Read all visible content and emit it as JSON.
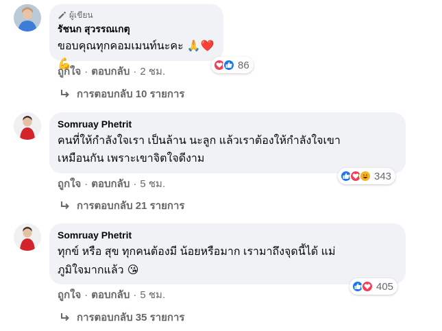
{
  "comments": [
    {
      "badge": "ผู้เขียน",
      "author": "รัชนก สุวรรณเกตุ",
      "lines": [
        "ขอบคุณทุกคอมเมนท์นะคะ 🙏❤️💪"
      ],
      "reaction_count": "86",
      "reaction_icons": [
        "love-icon",
        "like-icon"
      ],
      "like_label": "ถูกใจ",
      "reply_label": "ตอบกลับ",
      "time": "2 ชม.",
      "replies_label": "การตอบกลับ 10 รายการ"
    },
    {
      "author": "Somruay Phetrit",
      "lines": [
        "คนที่ให้กำลังใจเรา เป็นล้าน นะลูก แล้วเราต้องให้กำลังใจเขา",
        "เหมือนกัน เพราะเขาจิตใจดีงาม"
      ],
      "reaction_count": "343",
      "reaction_icons": [
        "like-icon",
        "love-icon",
        "haha-icon"
      ],
      "like_label": "ถูกใจ",
      "reply_label": "ตอบกลับ",
      "time": "5 ชม.",
      "replies_label": "การตอบกลับ 21 รายการ"
    },
    {
      "author": "Somruay Phetrit",
      "lines": [
        "ทุกข์ หรือ สุข ทุกคนต้องมี น้อยหรือมาก เรามาถึงจุดนี้ได้ แม่",
        "ภูมิใจมากแล้ว 😘"
      ],
      "reaction_count": "405",
      "reaction_icons": [
        "like-icon",
        "love-icon"
      ],
      "like_label": "ถูกใจ",
      "reply_label": "ตอบกลับ",
      "time": "5 ชม.",
      "replies_label": "การตอบกลับ 35 รายการ"
    }
  ],
  "colors": {
    "like": "#1877f2",
    "love": "#f33e58",
    "haha": "#f7b125",
    "bubble": "#f0f2f5",
    "secondary_text": "#65676b"
  }
}
